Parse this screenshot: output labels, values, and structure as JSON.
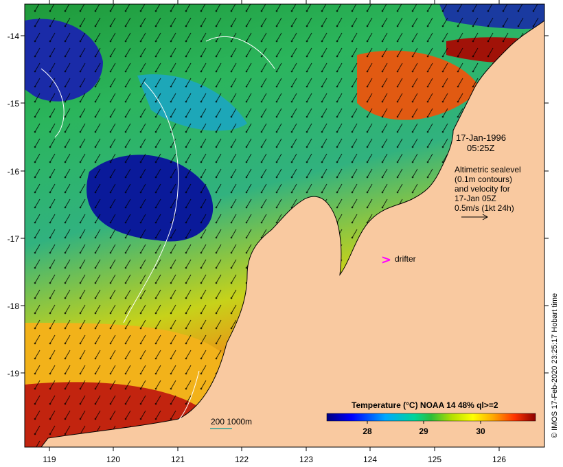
{
  "map": {
    "lon_ticks": [
      "119",
      "120",
      "121",
      "122",
      "123",
      "124",
      "125",
      "126"
    ],
    "lat_ticks": [
      "-14",
      "-15",
      "-16",
      "-17",
      "-18",
      "-19"
    ],
    "date_line1": "17-Jan-1996",
    "date_line2": "05:25Z",
    "info_lines": [
      "Altimetric sealevel",
      "(0.1m contours)",
      "and velocity for",
      "17-Jan 05Z",
      "0.5m/s (1kt 24h)"
    ],
    "drifter_symbol": ">",
    "drifter_label": "drifter",
    "depth_label": "200  1000m",
    "colorbar": {
      "title": "Temperature (°C) NOAA 14 48% ql>=2",
      "ticks": [
        "28",
        "29",
        "30"
      ]
    },
    "credit": "© IMOS 17-Feb-2020 23:25:17 Hobart time",
    "colors": {
      "land": "#f9c9a0",
      "coast": "#000000",
      "drifter": "#ff00ff",
      "depth_contour": "#2aa198"
    }
  }
}
